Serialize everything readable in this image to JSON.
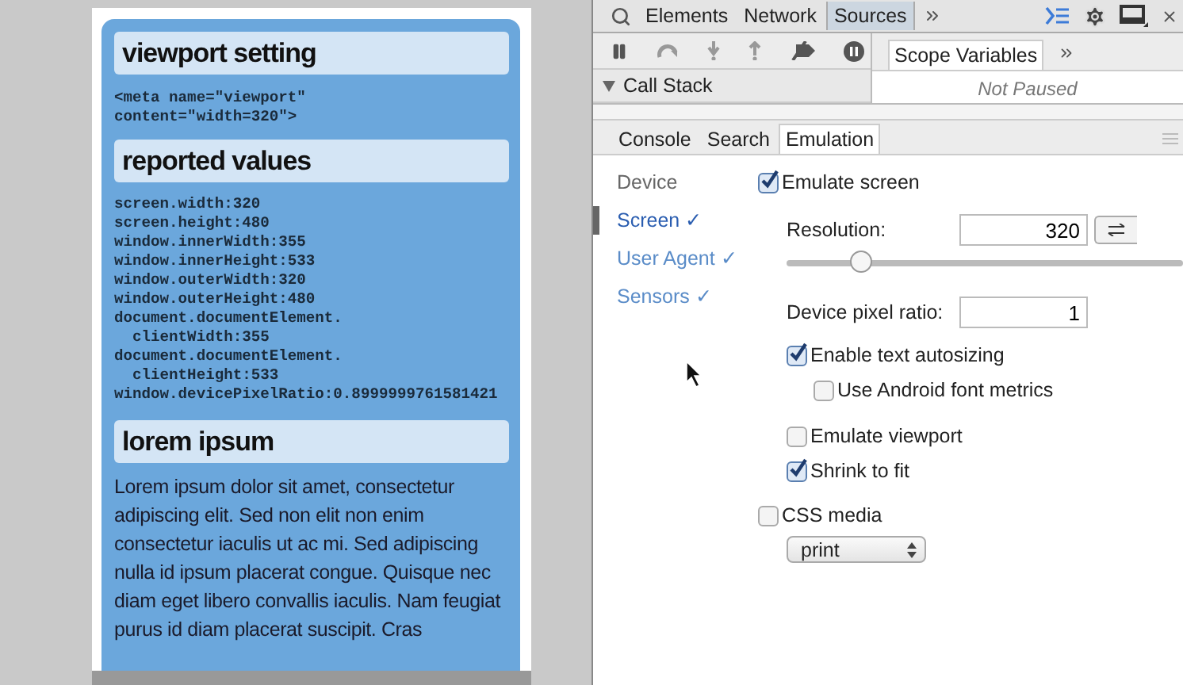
{
  "emulated_page": {
    "sections": [
      {
        "heading": "viewport setting",
        "kind": "code",
        "lines": [
          "<meta name=\"viewport\"",
          "content=\"width=320\">"
        ]
      },
      {
        "heading": "reported values",
        "kind": "code",
        "lines": [
          "screen.width:320",
          "screen.height:480",
          "window.innerWidth:355",
          "window.innerHeight:533",
          "window.outerWidth:320",
          "window.outerHeight:480",
          "document.documentElement.",
          "  clientWidth:355",
          "document.documentElement.",
          "  clientHeight:533",
          "window.devicePixelRatio:0.8999999761581421"
        ]
      },
      {
        "heading": "lorem ipsum",
        "kind": "paragraph",
        "text": "Lorem ipsum dolor sit amet, consectetur adipiscing elit. Sed non elit non enim consectetur iaculis ut ac mi. Sed adipiscing nulla id ipsum placerat congue. Quisque nec diam eget libero convallis iaculis. Nam feugiat purus id diam placerat suscipit. Cras"
      }
    ]
  },
  "devtools": {
    "main_tabs": [
      {
        "label": "Elements",
        "selected": false
      },
      {
        "label": "Network",
        "selected": false
      },
      {
        "label": "Sources",
        "selected": true
      }
    ],
    "sidebar_tabs": [
      {
        "label": "Scope Variables",
        "selected": true
      }
    ],
    "call_stack": {
      "title": "Call Stack",
      "expanded": true
    },
    "scope_status": "Not Paused",
    "drawer_tabs": [
      {
        "label": "Console",
        "selected": false
      },
      {
        "label": "Search",
        "selected": false
      },
      {
        "label": "Emulation",
        "selected": true
      }
    ],
    "emulation_sections": [
      {
        "label": "Device",
        "selected": false
      },
      {
        "label": "Screen ✓",
        "selected": true
      },
      {
        "label": "User Agent ✓",
        "selected": false
      },
      {
        "label": "Sensors ✓",
        "selected": false
      }
    ],
    "screen": {
      "emulate_screen": {
        "label": "Emulate screen",
        "checked": true
      },
      "resolution": {
        "label": "Resolution:",
        "value": "320"
      },
      "resolution_slider": {
        "level": 0.19
      },
      "device_pixel_ratio": {
        "label": "Device pixel ratio:",
        "value": "1"
      },
      "options": [
        {
          "label": "Enable text autosizing",
          "checked": true,
          "children": [
            {
              "label": "Use Android font metrics",
              "checked": false
            }
          ]
        },
        {
          "label": "Emulate viewport",
          "checked": false
        },
        {
          "label": "Shrink to fit",
          "checked": true
        }
      ],
      "css_media": {
        "label": "CSS media",
        "checked": false,
        "value": "print"
      }
    }
  }
}
